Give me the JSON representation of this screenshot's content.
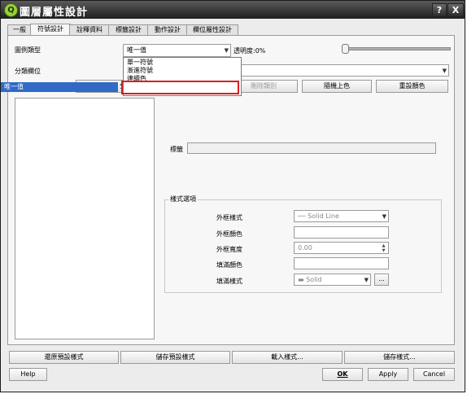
{
  "window": {
    "title": "圖層屬性設計",
    "help_label": "?",
    "close_label": "X"
  },
  "tabs": [
    {
      "label": "一般"
    },
    {
      "label": "符號設計"
    },
    {
      "label": "詮釋資料"
    },
    {
      "label": "標籤設計"
    },
    {
      "label": "動作設計"
    },
    {
      "label": "欄位屬性設計"
    }
  ],
  "legend": {
    "label": "圖例類型",
    "selected": "唯一值"
  },
  "transparency": {
    "label": "透明度:0%",
    "value_percent": 0
  },
  "dropdown": {
    "options": [
      "單一符號",
      "漸進符號",
      "連續色",
      "唯一值"
    ],
    "highlighted": "唯一值"
  },
  "classify_field": {
    "label": "分類欄位"
  },
  "buttons": {
    "classify": "分類",
    "delete_class": "刪除類別",
    "random_colors": "隨機上色",
    "reset_colors": "重設顏色"
  },
  "label_field": {
    "label": "標籤",
    "value": ""
  },
  "style_options": {
    "title": "樣式選項",
    "outline_style": {
      "label": "外框樣式",
      "value": "── Solid Line"
    },
    "outline_color": {
      "label": "外框顏色"
    },
    "outline_width": {
      "label": "外框寬度",
      "value": "0.00"
    },
    "fill_color": {
      "label": "填滿顏色"
    },
    "fill_style": {
      "label": "填滿樣式",
      "value": "▬ Solid",
      "more_button": "..."
    }
  },
  "bottom_buttons": {
    "restore_default": "還原預設樣式",
    "save_default": "儲存預設樣式",
    "load_style": "載入樣式...",
    "save_style": "儲存樣式..."
  },
  "dialog_buttons": {
    "help": "Help",
    "ok": "OK",
    "apply": "Apply",
    "cancel": "Cancel"
  },
  "colors": {
    "highlight": "#316ac5",
    "annotation": "#d41f1f",
    "title_bar": "#2a2a2a"
  }
}
